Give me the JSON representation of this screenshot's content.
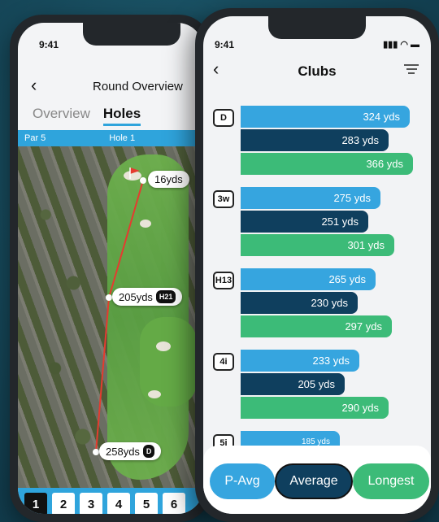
{
  "back_phone": {
    "time": "9:41",
    "title": "Round Overview",
    "tabs": {
      "overview": "Overview",
      "holes": "Holes"
    },
    "hole_bar": {
      "par": "Par 5",
      "hole": "Hole 1"
    },
    "shots": [
      {
        "distance": "16yds",
        "club": ""
      },
      {
        "distance": "205yds",
        "club": "H21"
      },
      {
        "distance": "258yds",
        "club": "D"
      }
    ],
    "hole_numbers": [
      "1",
      "2",
      "3",
      "4",
      "5",
      "6"
    ]
  },
  "front_phone": {
    "time": "9:41",
    "status_icons": "▮▮▮ ◠ ▬",
    "title": "Clubs",
    "clubs": [
      {
        "label": "D",
        "p_avg": "324 yds",
        "average": "283 yds",
        "longest": "366 yds"
      },
      {
        "label": "3w",
        "p_avg": "275 yds",
        "average": "251 yds",
        "longest": "301 yds"
      },
      {
        "label": "H13",
        "p_avg": "265 yds",
        "average": "230 yds",
        "longest": "297 yds"
      },
      {
        "label": "4i",
        "p_avg": "233 yds",
        "average": "205 yds",
        "longest": "290 yds"
      },
      {
        "label": "5i",
        "p_avg": "185 yds",
        "average": "",
        "longest": ""
      }
    ],
    "segments": {
      "p_avg": "P-Avg",
      "average": "Average",
      "longest": "Longest"
    }
  },
  "colors": {
    "p_avg": "#36a5df",
    "average": "#0f3f5e",
    "longest": "#3cbb78",
    "accent": "#2fa4dc"
  }
}
